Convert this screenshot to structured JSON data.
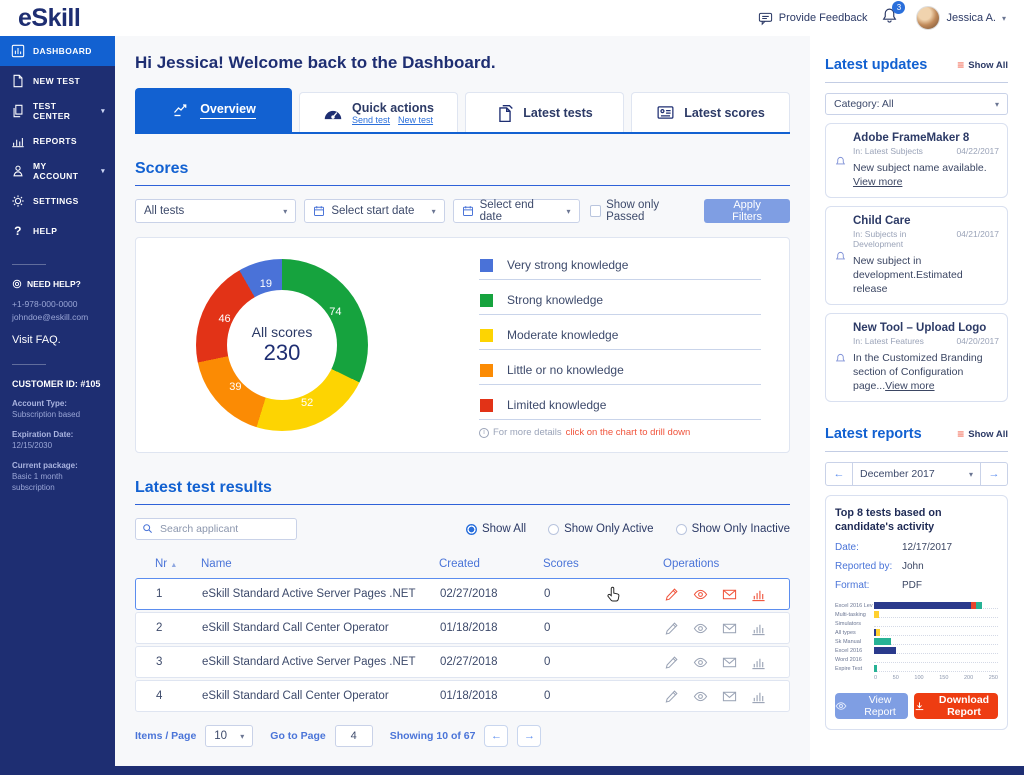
{
  "header": {
    "logo": "eSkill",
    "provide_feedback": "Provide Feedback",
    "notification_count": "3",
    "user_name": "Jessica A."
  },
  "sidebar": {
    "items": [
      {
        "label": "DASHBOARD"
      },
      {
        "label": "NEW TEST"
      },
      {
        "label": "TEST CENTER"
      },
      {
        "label": "REPORTS"
      },
      {
        "label": "MY ACCOUNT"
      },
      {
        "label": "SETTINGS"
      },
      {
        "label": "HELP"
      }
    ],
    "need_help": {
      "title": "NEED HELP?",
      "phone": "+1-978-000-0000",
      "email": "johndoe@eskill.com",
      "faq": "Visit FAQ."
    },
    "customer": {
      "id": "CUSTOMER ID: #105",
      "account_type_label": "Account Type:",
      "account_type": "Subscription based",
      "expiration_label": "Expiration Date:",
      "expiration": "12/15/2030",
      "package_label": "Current package:",
      "package": "Basic 1 month subscription"
    }
  },
  "main": {
    "welcome": "Hi Jessica! Welcome back to the Dashboard.",
    "tabs": [
      {
        "label": "Overview"
      },
      {
        "label": "Quick actions",
        "links": [
          "Send test",
          "New test"
        ]
      },
      {
        "label": "Latest tests"
      },
      {
        "label": "Latest scores"
      }
    ],
    "scores": {
      "title": "Scores",
      "filters": {
        "tests": "All tests",
        "start_date": "Select start date",
        "end_date": "Select end date",
        "checkbox": "Show only Passed",
        "apply": "Apply Filters"
      },
      "note_prefix": "For more details ",
      "note_link": "click on the chart to drill down"
    },
    "results": {
      "title": "Latest test results",
      "search_placeholder": "Search applicant",
      "radios": [
        {
          "label": "Show All"
        },
        {
          "label": "Show Only Active"
        },
        {
          "label": "Show Only Inactive"
        }
      ],
      "columns": [
        "Nr",
        "Name",
        "Created",
        "Scores",
        "Operations"
      ],
      "rows": [
        {
          "nr": "1",
          "name": "eSkill Standard Active Server Pages .NET",
          "created": "02/27/2018",
          "scores": "0"
        },
        {
          "nr": "2",
          "name": "eSkill Standard Call Center Operator",
          "created": "01/18/2018",
          "scores": "0"
        },
        {
          "nr": "3",
          "name": "eSkill Standard Active Server Pages .NET",
          "created": "02/27/2018",
          "scores": "0"
        },
        {
          "nr": "4",
          "name": "eSkill Standard Call Center Operator",
          "created": "01/18/2018",
          "scores": "0"
        }
      ],
      "pagination": {
        "items_per_page_label": "Items / Page",
        "items_per_page": "10",
        "goto_label": "Go to Page",
        "goto_value": "4",
        "showing": "Showing 10 of 67"
      }
    }
  },
  "updates": {
    "title": "Latest updates",
    "show_all": "Show All",
    "category": "Category: All",
    "cards": [
      {
        "title": "Adobe FrameMaker 8",
        "meta": "In: Latest Subjects",
        "date": "04/22/2017",
        "body": "New subject name available. ",
        "link": "View more"
      },
      {
        "title": "Child Care",
        "meta": "In: Subjects in Development",
        "date": "04/21/2017",
        "body": "New subject in development.Estimated release",
        "link": ""
      },
      {
        "title": "New Tool – Upload Logo",
        "meta": "In: Latest Features",
        "date": "04/20/2017",
        "body": "In the Customized Branding section of Configuration page...",
        "link": "View more"
      }
    ]
  },
  "reports": {
    "title": "Latest reports",
    "show_all": "Show All",
    "month": "December 2017",
    "card": {
      "title": "Top 8 tests based on candidate's activity",
      "date_label": "Date:",
      "date": "12/17/2017",
      "reported_label": "Reported by:",
      "reported": "John",
      "format_label": "Format:",
      "format": "PDF",
      "view_btn": "View Report",
      "download_btn": "Download Report"
    }
  },
  "chart_data": [
    {
      "type": "donut",
      "center_label": "All scores",
      "center_value": "230",
      "segments": [
        {
          "label": "Strong knowledge",
          "value": 74,
          "color": "#16a33e"
        },
        {
          "label": "Moderate knowledge",
          "value": 52,
          "color": "#fdd402"
        },
        {
          "label": "Little or no knowledge",
          "value": 39,
          "color": "#fb8b04"
        },
        {
          "label": "Limited knowledge",
          "value": 46,
          "color": "#e23317"
        },
        {
          "label": "Very strong knowledge",
          "value": 19,
          "color": "#4a72d8"
        }
      ],
      "legend": [
        {
          "label": "Very strong knowledge",
          "color": "#4a72d8"
        },
        {
          "label": "Strong knowledge",
          "color": "#16a33e"
        },
        {
          "label": "Moderate knowledge",
          "color": "#fdd402"
        },
        {
          "label": "Little or no knowledge",
          "color": "#fb8b04"
        },
        {
          "label": "Limited knowledge",
          "color": "#e23317"
        }
      ]
    },
    {
      "type": "bar",
      "orientation": "horizontal",
      "xmax": 250,
      "xticks": [
        "0",
        "50",
        "100",
        "150",
        "200",
        "250"
      ],
      "rows": [
        {
          "label": "Excel 2016 Lev",
          "segments": [
            {
              "color": "#2a3a8c",
              "value": 195
            },
            {
              "color": "#e8442c",
              "value": 10
            },
            {
              "color": "#27b295",
              "value": 13
            }
          ]
        },
        {
          "label": "Multi-tasking",
          "segments": [
            {
              "color": "#ffd02e",
              "value": 10
            }
          ]
        },
        {
          "label": "Simulators",
          "segments": []
        },
        {
          "label": "All types",
          "segments": [
            {
              "color": "#2a3a8c",
              "value": 4
            },
            {
              "color": "#ffd02e",
              "value": 9
            }
          ]
        },
        {
          "label": "Sk Manual",
          "segments": [
            {
              "color": "#27b295",
              "value": 35
            }
          ]
        },
        {
          "label": "Excel 2016",
          "segments": [
            {
              "color": "#2a3a8c",
              "value": 45
            }
          ]
        },
        {
          "label": "Word 2016",
          "segments": []
        },
        {
          "label": "Expire Test",
          "segments": [
            {
              "color": "#27b295",
              "value": 6
            }
          ]
        }
      ]
    }
  ],
  "colors": {
    "primary_blue": "#1261d1",
    "sidebar_navy": "#1e2e72",
    "accent_red": "#f0543c",
    "periwinkle": "#7f9ee3",
    "download_red": "#ee3d12"
  }
}
